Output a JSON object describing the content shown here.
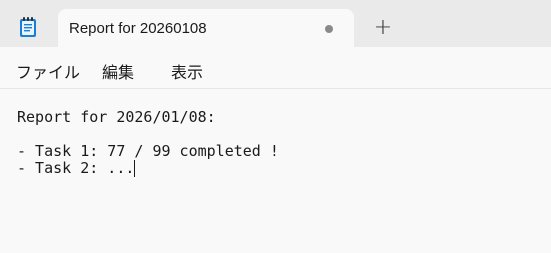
{
  "app": {
    "icon": "notepad-icon"
  },
  "tab": {
    "title": "Report for 20260108",
    "modified_indicator": "unsaved-dot-icon"
  },
  "new_tab": {
    "label": "+"
  },
  "menu": {
    "items": [
      {
        "label": "ファイル"
      },
      {
        "label": "編集"
      },
      {
        "label": "表示"
      }
    ]
  },
  "document": {
    "lines": [
      "Report for 2026/01/08:",
      "",
      "- Task 1: 77 / 99 completed !",
      "- Task 2: ..."
    ]
  }
}
